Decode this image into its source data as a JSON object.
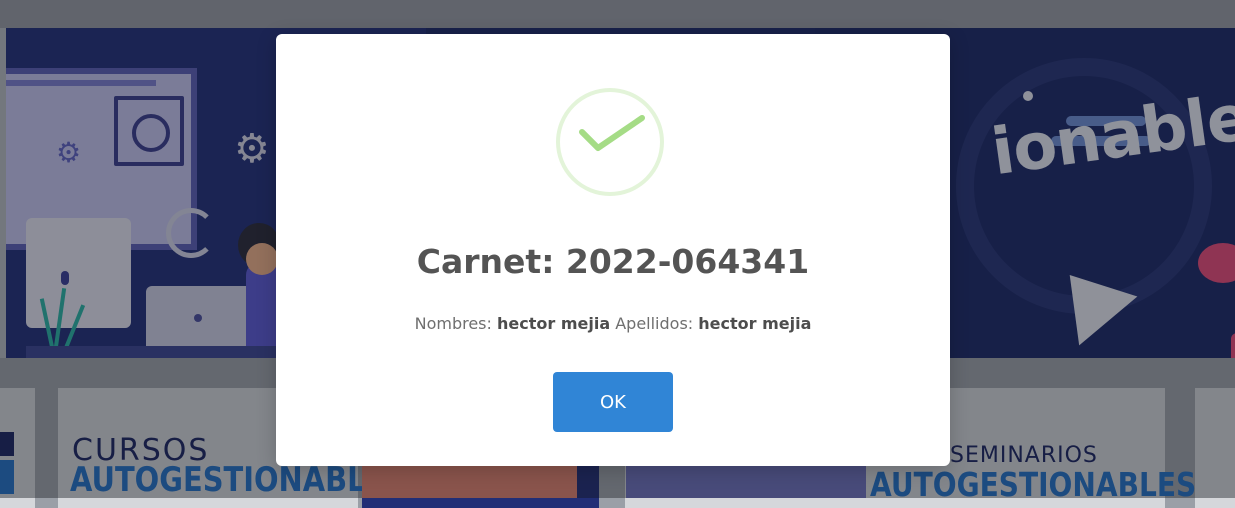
{
  "background": {
    "banner_word": "ionables",
    "cards": [
      {
        "title_top": "CURSOS",
        "title_bottom": "AUTOGESTIONABLES"
      },
      {
        "title_top": "SEMINARIOS",
        "title_bottom": "AUTOGESTIONABLES"
      }
    ]
  },
  "modal": {
    "icon": "check-icon",
    "title": "Carnet: 2022-064341",
    "nombres_label": "Nombres:",
    "nombres_value": "hector mejia",
    "apellidos_label": "Apellidos:",
    "apellidos_value": "hector mejia",
    "ok_label": "OK"
  },
  "colors": {
    "accent": "#3085d6",
    "success": "#a5dc86",
    "success_ring": "#e3f4d9"
  }
}
